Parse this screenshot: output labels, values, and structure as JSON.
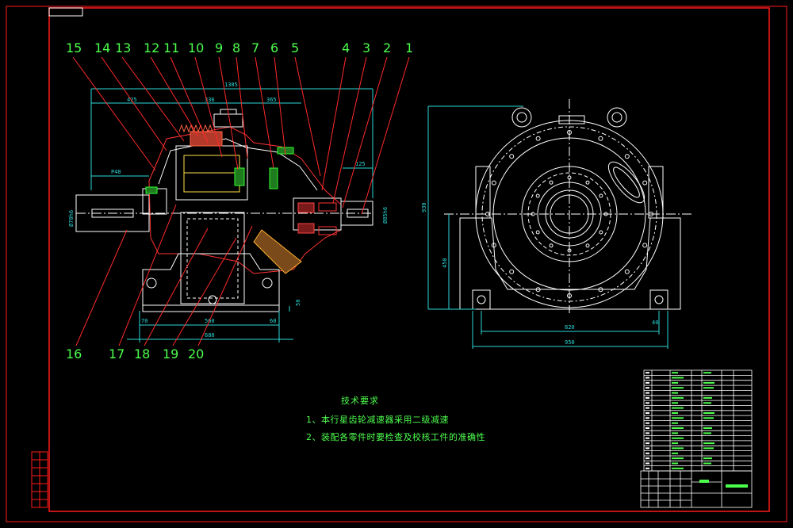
{
  "drawing": {
    "frame_color": "#ff1a1a",
    "line_color": "#ffffff",
    "dim_color": "#2bd9d9",
    "callout_color": "#4dff4d",
    "callout_leader_color": "#ff2a2a",
    "top_callouts": [
      "15",
      "14",
      "13",
      "12",
      "11",
      "10",
      "9",
      "8",
      "7",
      "6",
      "5",
      "4",
      "3",
      "2",
      "1"
    ],
    "bottom_callouts": [
      "16",
      "17",
      "18",
      "19",
      "20"
    ],
    "side_view_dims": {
      "overall": "1385",
      "left": "425",
      "middle": "336",
      "right": "365",
      "key_length": "P40",
      "shaft_right": "125",
      "input_dia": "Ø70h6",
      "output_dia": "Ø85h6",
      "base_inner": "560",
      "base_outer": "680",
      "base_left": "70",
      "base_right": "60",
      "base_height": "50"
    },
    "end_view_dims": {
      "height_total": "930",
      "center_height": "450",
      "width_inner": "820",
      "width_outer": "950",
      "foot": "40"
    }
  },
  "tech_requirements": {
    "title": "技术要求",
    "items": [
      "1、本行星齿轮减速器采用二级减速",
      "2、装配各零件时要检查及校核工件的准确性"
    ]
  },
  "title_block": {
    "rows": 20
  }
}
